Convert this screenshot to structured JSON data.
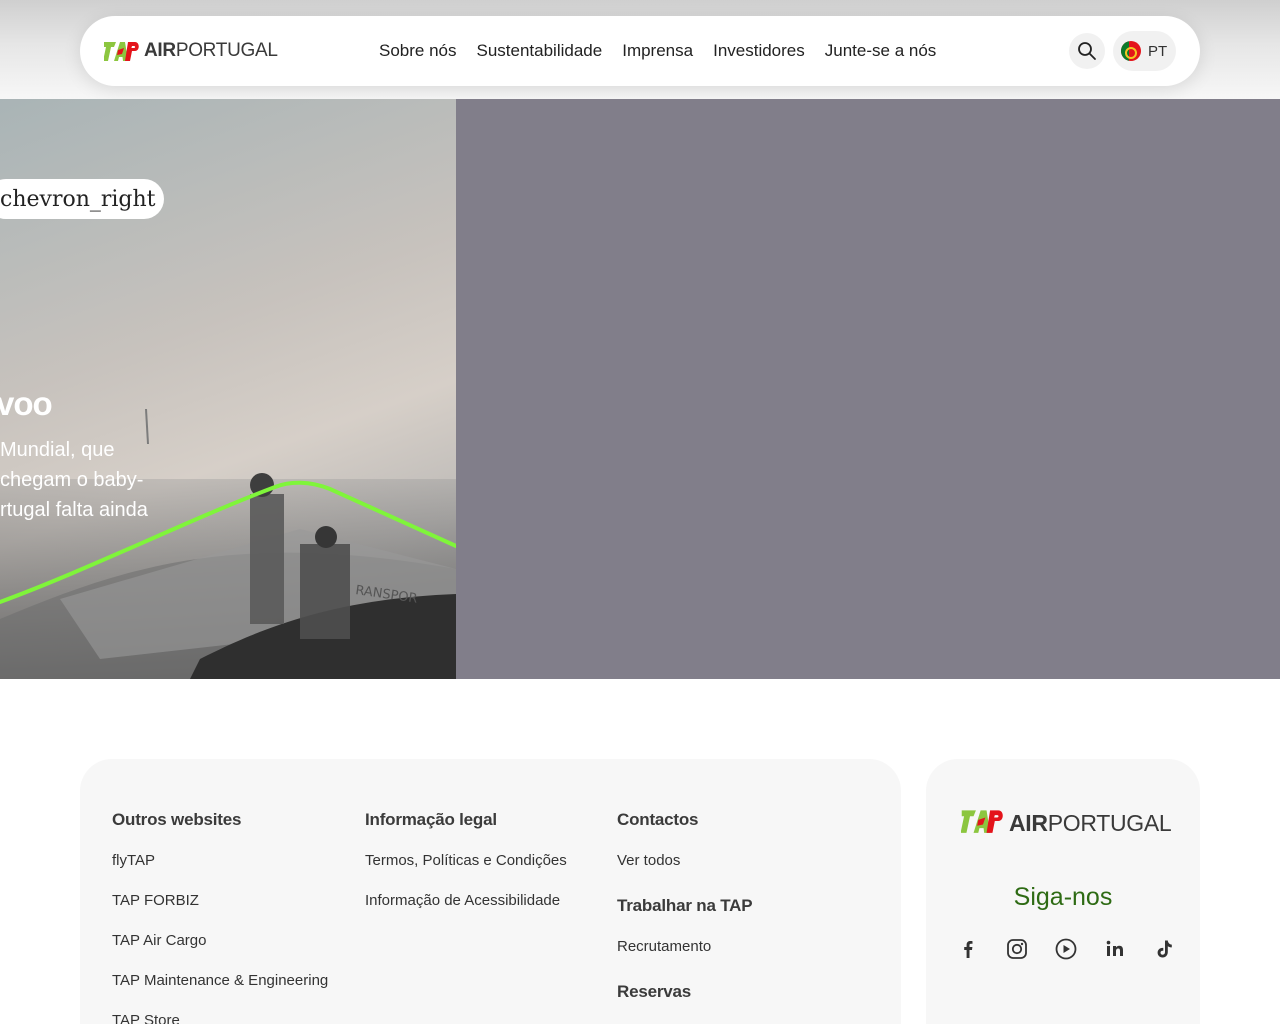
{
  "header": {
    "logo_text_bold": "AIR",
    "logo_text": "PORTUGAL",
    "nav": [
      "Sobre nós",
      "Sustentabilidade",
      "Imprensa",
      "Investidores",
      "Junte-se a nós"
    ],
    "lang_label": "PT"
  },
  "hero": {
    "chip_label": "chevron_right",
    "title": "voo",
    "text_lines": [
      "Mundial, que",
      "chegam o baby-",
      "rtugal falta ainda"
    ],
    "panel_color": "#817e8a",
    "accent_line_color": "#7ff53a"
  },
  "footer": {
    "columns": [
      {
        "title": "Outros websites",
        "items": [
          "flyTAP",
          "TAP FORBIZ",
          "TAP Air Cargo",
          "TAP Maintenance & Engineering",
          "TAP Store"
        ]
      },
      {
        "title": "Informação legal",
        "items": [
          "Termos, Políticas e Condições",
          "Informação de Acessibilidade"
        ]
      },
      {
        "title": "Contactos",
        "items": [
          "Ver todos"
        ]
      }
    ],
    "careers": {
      "title": "Trabalhar na TAP",
      "items": [
        "Recrutamento"
      ]
    },
    "cut_heading": "Reservas",
    "logo_text_bold": "AIR",
    "logo_text": "PORTUGAL",
    "follow_label": "Siga-nos",
    "socials": [
      "facebook-icon",
      "instagram-icon",
      "youtube-icon",
      "linkedin-icon",
      "tiktok-icon"
    ],
    "follow_color": "#2e6b14"
  },
  "brand": {
    "red": "#e4141b",
    "green": "#8cc63f"
  }
}
